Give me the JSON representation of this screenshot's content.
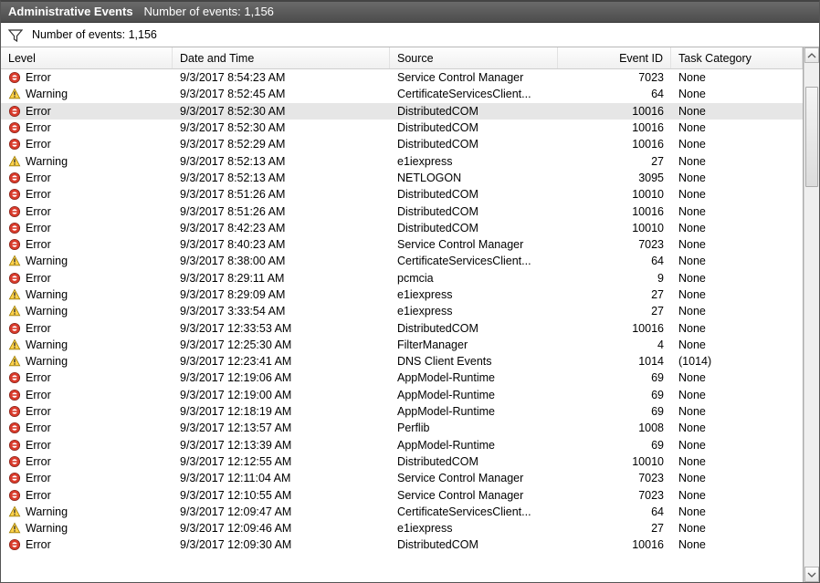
{
  "titlebar": {
    "title": "Administrative Events",
    "count_label": "Number of events: 1,156"
  },
  "filterbar": {
    "count_label": "Number of events: 1,156"
  },
  "columns": {
    "level": "Level",
    "datetime": "Date and Time",
    "source": "Source",
    "eventid": "Event ID",
    "task": "Task Category"
  },
  "levels_label": {
    "error": "Error",
    "warning": "Warning"
  },
  "rows": [
    {
      "level": "error",
      "datetime": "9/3/2017 8:54:23 AM",
      "source": "Service Control Manager",
      "eventid": "7023",
      "task": "None",
      "selected": false
    },
    {
      "level": "warning",
      "datetime": "9/3/2017 8:52:45 AM",
      "source": "CertificateServicesClient...",
      "eventid": "64",
      "task": "None",
      "selected": false
    },
    {
      "level": "error",
      "datetime": "9/3/2017 8:52:30 AM",
      "source": "DistributedCOM",
      "eventid": "10016",
      "task": "None",
      "selected": true
    },
    {
      "level": "error",
      "datetime": "9/3/2017 8:52:30 AM",
      "source": "DistributedCOM",
      "eventid": "10016",
      "task": "None",
      "selected": false
    },
    {
      "level": "error",
      "datetime": "9/3/2017 8:52:29 AM",
      "source": "DistributedCOM",
      "eventid": "10016",
      "task": "None",
      "selected": false
    },
    {
      "level": "warning",
      "datetime": "9/3/2017 8:52:13 AM",
      "source": "e1iexpress",
      "eventid": "27",
      "task": "None",
      "selected": false
    },
    {
      "level": "error",
      "datetime": "9/3/2017 8:52:13 AM",
      "source": "NETLOGON",
      "eventid": "3095",
      "task": "None",
      "selected": false
    },
    {
      "level": "error",
      "datetime": "9/3/2017 8:51:26 AM",
      "source": "DistributedCOM",
      "eventid": "10010",
      "task": "None",
      "selected": false
    },
    {
      "level": "error",
      "datetime": "9/3/2017 8:51:26 AM",
      "source": "DistributedCOM",
      "eventid": "10016",
      "task": "None",
      "selected": false
    },
    {
      "level": "error",
      "datetime": "9/3/2017 8:42:23 AM",
      "source": "DistributedCOM",
      "eventid": "10010",
      "task": "None",
      "selected": false
    },
    {
      "level": "error",
      "datetime": "9/3/2017 8:40:23 AM",
      "source": "Service Control Manager",
      "eventid": "7023",
      "task": "None",
      "selected": false
    },
    {
      "level": "warning",
      "datetime": "9/3/2017 8:38:00 AM",
      "source": "CertificateServicesClient...",
      "eventid": "64",
      "task": "None",
      "selected": false
    },
    {
      "level": "error",
      "datetime": "9/3/2017 8:29:11 AM",
      "source": "pcmcia",
      "eventid": "9",
      "task": "None",
      "selected": false
    },
    {
      "level": "warning",
      "datetime": "9/3/2017 8:29:09 AM",
      "source": "e1iexpress",
      "eventid": "27",
      "task": "None",
      "selected": false
    },
    {
      "level": "warning",
      "datetime": "9/3/2017 3:33:54 AM",
      "source": "e1iexpress",
      "eventid": "27",
      "task": "None",
      "selected": false
    },
    {
      "level": "error",
      "datetime": "9/3/2017 12:33:53 AM",
      "source": "DistributedCOM",
      "eventid": "10016",
      "task": "None",
      "selected": false
    },
    {
      "level": "warning",
      "datetime": "9/3/2017 12:25:30 AM",
      "source": "FilterManager",
      "eventid": "4",
      "task": "None",
      "selected": false
    },
    {
      "level": "warning",
      "datetime": "9/3/2017 12:23:41 AM",
      "source": "DNS Client Events",
      "eventid": "1014",
      "task": "(1014)",
      "selected": false
    },
    {
      "level": "error",
      "datetime": "9/3/2017 12:19:06 AM",
      "source": "AppModel-Runtime",
      "eventid": "69",
      "task": "None",
      "selected": false
    },
    {
      "level": "error",
      "datetime": "9/3/2017 12:19:00 AM",
      "source": "AppModel-Runtime",
      "eventid": "69",
      "task": "None",
      "selected": false
    },
    {
      "level": "error",
      "datetime": "9/3/2017 12:18:19 AM",
      "source": "AppModel-Runtime",
      "eventid": "69",
      "task": "None",
      "selected": false
    },
    {
      "level": "error",
      "datetime": "9/3/2017 12:13:57 AM",
      "source": "Perflib",
      "eventid": "1008",
      "task": "None",
      "selected": false
    },
    {
      "level": "error",
      "datetime": "9/3/2017 12:13:39 AM",
      "source": "AppModel-Runtime",
      "eventid": "69",
      "task": "None",
      "selected": false
    },
    {
      "level": "error",
      "datetime": "9/3/2017 12:12:55 AM",
      "source": "DistributedCOM",
      "eventid": "10010",
      "task": "None",
      "selected": false
    },
    {
      "level": "error",
      "datetime": "9/3/2017 12:11:04 AM",
      "source": "Service Control Manager",
      "eventid": "7023",
      "task": "None",
      "selected": false
    },
    {
      "level": "error",
      "datetime": "9/3/2017 12:10:55 AM",
      "source": "Service Control Manager",
      "eventid": "7023",
      "task": "None",
      "selected": false
    },
    {
      "level": "warning",
      "datetime": "9/3/2017 12:09:47 AM",
      "source": "CertificateServicesClient...",
      "eventid": "64",
      "task": "None",
      "selected": false
    },
    {
      "level": "warning",
      "datetime": "9/3/2017 12:09:46 AM",
      "source": "e1iexpress",
      "eventid": "27",
      "task": "None",
      "selected": false
    },
    {
      "level": "error",
      "datetime": "9/3/2017 12:09:30 AM",
      "source": "DistributedCOM",
      "eventid": "10016",
      "task": "None",
      "selected": false
    }
  ]
}
